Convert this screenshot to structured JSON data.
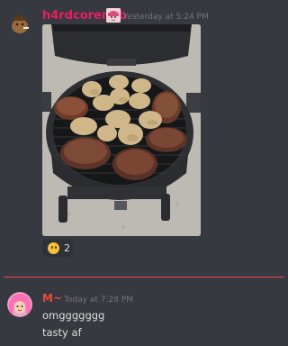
{
  "messages": [
    {
      "author": "h4rdcorenub",
      "author_color": "#e91e63",
      "badge_icon": "anime-avatar-badge",
      "timestamp": "Yesterday at 5:24 PM",
      "attachment": "grill-photo",
      "reactions": [
        {
          "emoji": "grinning-face",
          "count": "2"
        }
      ]
    },
    {
      "author": "M~",
      "author_color": "#e74c3c",
      "timestamp": "Today at 7:28 PM",
      "lines": [
        "omggggggg",
        "tasty af"
      ]
    }
  ],
  "colors": {
    "background": "#36393f",
    "new_messages_divider": "#f04747",
    "timestamp": "#72767d",
    "text": "#dcddde"
  }
}
